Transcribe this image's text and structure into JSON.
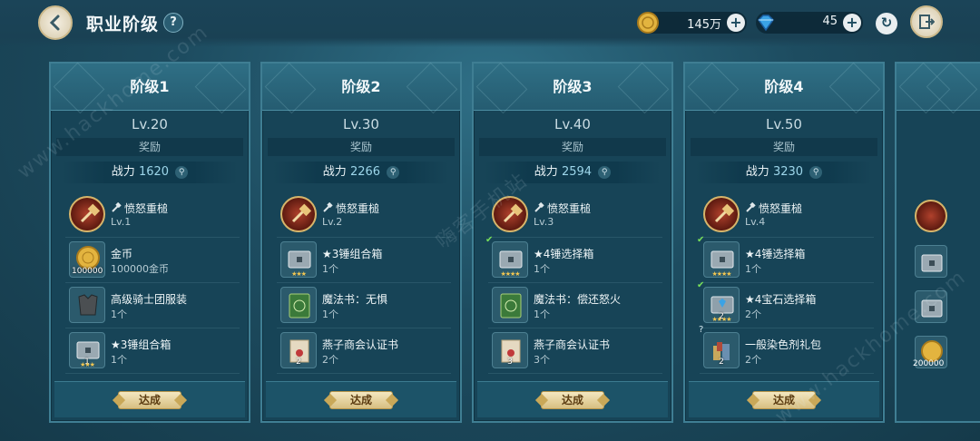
{
  "header": {
    "title": "职业阶级",
    "help_label": "?",
    "gold_value": "145万",
    "gem_value": "45",
    "plus_label": "+"
  },
  "colors": {
    "accent": "#3f7e93",
    "badge": "#d7bf81",
    "gold": "#e3b43f",
    "gem": "#3aa3e6"
  },
  "common": {
    "reward_label": "奖励",
    "power_label": "战力",
    "achieved_label": "达成"
  },
  "cards": [
    {
      "title": "阶级1",
      "level": "Lv.20",
      "power": "1620",
      "items": [
        {
          "name": "愤怒重槌",
          "sub": "Lv.1",
          "icon": "hammer-skill-icon"
        },
        {
          "name": "金币",
          "sub": "100000金币",
          "qty": "100000",
          "icon": "gold-coin-icon"
        },
        {
          "name": "高级骑士团服装",
          "sub": "1个",
          "icon": "armor-icon"
        },
        {
          "name": "★3锤组合箱",
          "sub": "1个",
          "qty": "1",
          "stars": "★★★",
          "icon": "chest-icon"
        }
      ]
    },
    {
      "title": "阶级2",
      "level": "Lv.30",
      "power": "2266",
      "items": [
        {
          "name": "愤怒重槌",
          "sub": "Lv.2",
          "icon": "hammer-skill-icon"
        },
        {
          "name": "★3锤组合箱",
          "sub": "1个",
          "stars": "★★★",
          "icon": "chest-icon"
        },
        {
          "name": "魔法书：无惧",
          "sub": "1个",
          "icon": "magic-book-icon"
        },
        {
          "name": "燕子商会认证书",
          "sub": "2个",
          "qty": "2",
          "icon": "certificate-icon"
        }
      ]
    },
    {
      "title": "阶级3",
      "level": "Lv.40",
      "power": "2594",
      "items": [
        {
          "name": "愤怒重槌",
          "sub": "Lv.3",
          "icon": "hammer-skill-icon"
        },
        {
          "name": "★4锤选择箱",
          "sub": "1个",
          "stars": "★★★★",
          "check": true,
          "icon": "chest-icon"
        },
        {
          "name": "魔法书：偿还怒火",
          "sub": "1个",
          "icon": "magic-book-icon"
        },
        {
          "name": "燕子商会认证书",
          "sub": "3个",
          "qty": "3",
          "icon": "certificate-icon"
        }
      ]
    },
    {
      "title": "阶级4",
      "level": "Lv.50",
      "power": "3230",
      "items": [
        {
          "name": "愤怒重槌",
          "sub": "Lv.4",
          "icon": "hammer-skill-icon"
        },
        {
          "name": "★4锤选择箱",
          "sub": "1个",
          "stars": "★★★★",
          "check": true,
          "icon": "chest-icon"
        },
        {
          "name": "★4宝石选择箱",
          "sub": "2个",
          "qty": "2",
          "stars": "★★★★",
          "check": true,
          "icon": "gem-chest-icon"
        },
        {
          "name": "一般染色剂礼包",
          "sub": "2个",
          "qty": "2",
          "question": true,
          "icon": "dye-pack-icon"
        }
      ]
    }
  ],
  "partial_card": {
    "coin_qty": "200000"
  },
  "watermarks": [
    "www.hackhome.com",
    "嗨客手机站",
    "www.hackhome.com"
  ]
}
